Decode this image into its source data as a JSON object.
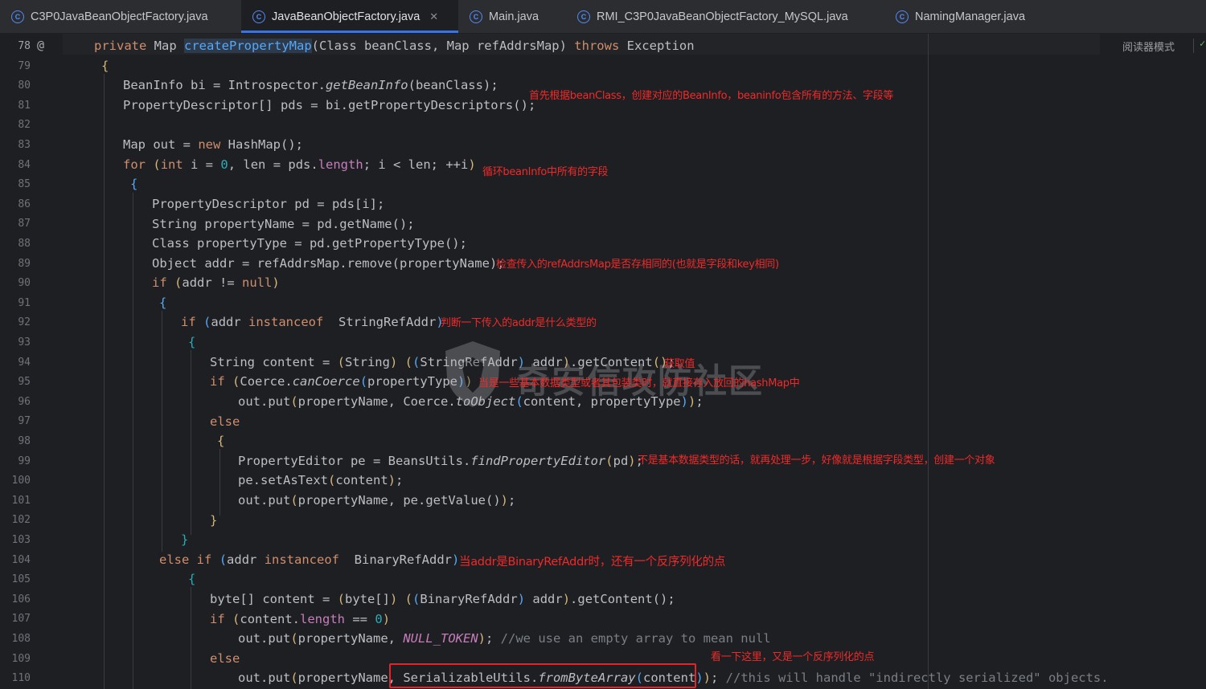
{
  "tabs": [
    {
      "label": "C3P0JavaBeanObjectFactory.java",
      "active": false
    },
    {
      "label": "JavaBeanObjectFactory.java",
      "active": true
    },
    {
      "label": "Main.java",
      "active": false
    },
    {
      "label": "RMI_C3P0JavaBeanObjectFactory_MySQL.java",
      "active": false
    },
    {
      "label": "NamingManager.java",
      "active": false
    }
  ],
  "tab_icon_glyph": "C",
  "close_glyph": "✕",
  "override_glyph": "@",
  "reader_mode": "阅读器模式",
  "line_numbers": [
    "78",
    "79",
    "80",
    "81",
    "82",
    "83",
    "84",
    "85",
    "86",
    "87",
    "88",
    "89",
    "90",
    "91",
    "92",
    "93",
    "94",
    "95",
    "96",
    "97",
    "98",
    "99",
    "100",
    "101",
    "102",
    "103",
    "104",
    "105",
    "106",
    "107",
    "108",
    "109",
    "110"
  ],
  "annotations": {
    "a1": "首先根据beanClass，创建对应的BeanInfo，beaninfo包含所有的方法、字段等",
    "a2": "循环beanInfo中所有的字段",
    "a3": "检查传入的refAddrsMap是否存相同的(也就是字段和key相同)",
    "a4": "判断一下传入的addr是什么类型的",
    "a5": "获取值",
    "a6": "当是一些基本数据类型或者其包装类时，就直接存入放回的hashMap中",
    "a7": "不是基本数据类型的话，就再处理一步，好像就是根据字段类型，创建一个对象",
    "a8": "当addr是BinaryRefAddr时，还有一个反序列化的点",
    "a9": "看一下这里，又是一个反序列化的点"
  },
  "watermark": "奇安信攻防社区",
  "colors": {
    "background": "#1e1f22",
    "keyword": "#cf8e6d",
    "method": "#56a8f5",
    "number": "#2aacb8",
    "field": "#c77dbb",
    "comment": "#7a7e85",
    "annotation_red": "#f02a2a",
    "tab_underline": "#3574f0"
  },
  "code_tokens": {
    "private": "private",
    "Map": "Map",
    "createPropertyMap": "createPropertyMap",
    "sig_params": "(Class beanClass, Map refAddrsMap) ",
    "throws": "throws",
    "Exception": " Exception",
    "lbrace": "{",
    "rbrace": "}",
    "lparen": "(",
    "rparen": ")",
    "semi": ";",
    "empty_call": "()",
    "beaninfo_decl": "BeanInfo bi = Introspector.",
    "getBeanInfo": "getBeanInfo",
    "beanClass": "beanClass",
    "pd_arr_decl": "PropertyDescriptor[] pds = bi.getPropertyDescriptors",
    "map_out": "Map out = ",
    "new": "new",
    "hashmap": " HashMap",
    "for": "for",
    "int": "int",
    "i_eq": " i = ",
    "zero": "0",
    "len_eq": ", len = pds.",
    "length": "length",
    "for_tail": "; i < len; ++i",
    "pd_decl": "PropertyDescriptor pd = pds",
    "lbrack": "[",
    "rbrack": "]",
    "i": "i",
    "str_pn": "String propertyName = pd.getName",
    "cls_pt": "Class propertyType = pd.getPropertyType",
    "obj_addr": "Object addr = refAddrsMap.remove",
    "propertyName": "propertyName",
    "if": "if",
    "addr": "addr",
    "neq": " != ",
    "null": "null",
    "instanceof": " instanceof ",
    "StringRefAddr": " StringRefAddr",
    "str_content": "String content = ",
    "String": "String",
    "sp": " ",
    "StringRefAddr2": "StringRefAddr",
    "addr_dot": " addr",
    "getContent_dot": ".getContent",
    "coerce_dot": "Coerce.",
    "canCoerce": "canCoerce",
    "propertyType": "propertyType",
    "out_put": "out.put",
    "pn_comma": "propertyName, ",
    "toObject": "toObject",
    "content_c": "content, ",
    "else": "else",
    "pe_decl": "PropertyEditor pe = BeansUtils.",
    "findPropertyEditor": "findPropertyEditor",
    "pd": "pd",
    "pe_set": "pe.setAsText",
    "content": "content",
    "pe_getvalue": "pe.getValue",
    "BinaryRefAddr": " BinaryRefAddr",
    "byte_content": "byte[] content = ",
    "byte_arr": "byte[]",
    "BinaryRefAddr2": "BinaryRefAddr",
    "content_dot": "content.",
    "eqeq": " == ",
    "NULL_TOKEN": "NULL_TOKEN",
    "comment_null": " //we use an empty array to mean null",
    "SerializableUtils": "SerializableUtils.",
    "fromByteArray": "fromByteArray",
    "comment_ser": " //this will handle \"indirectly serialized\" objects."
  }
}
